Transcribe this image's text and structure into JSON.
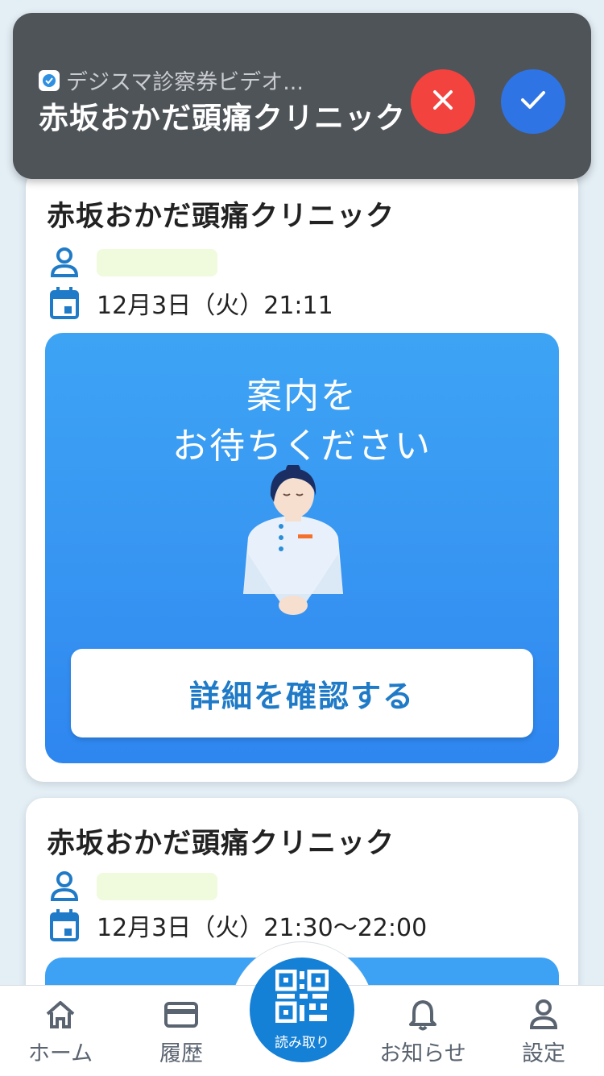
{
  "notification": {
    "app_name": "デジスマ診察券ビデオ...",
    "title": "赤坂おかだ頭痛クリニック",
    "reject_icon": "close-icon",
    "accept_icon": "check-icon",
    "colors": {
      "background": "#4f5459",
      "reject": "#f2433f",
      "accept": "#2f74e4"
    }
  },
  "cards": [
    {
      "clinic": "赤坂おかだ頭痛クリニック",
      "datetime": "12月3日（火）21:11",
      "status_line1": "案内を",
      "status_line2": "お待ちください",
      "detail_button": "詳細を確認する"
    },
    {
      "clinic": "赤坂おかだ頭痛クリニック",
      "datetime": "12月3日（火）21:30〜22:00"
    }
  ],
  "nav": {
    "home": "ホーム",
    "history": "履歴",
    "scan": "読み取り",
    "notices": "お知らせ",
    "settings": "設定"
  },
  "colors": {
    "accent": "#1480d6",
    "panel": "#3795f2",
    "page_bg": "#e3eef5"
  }
}
